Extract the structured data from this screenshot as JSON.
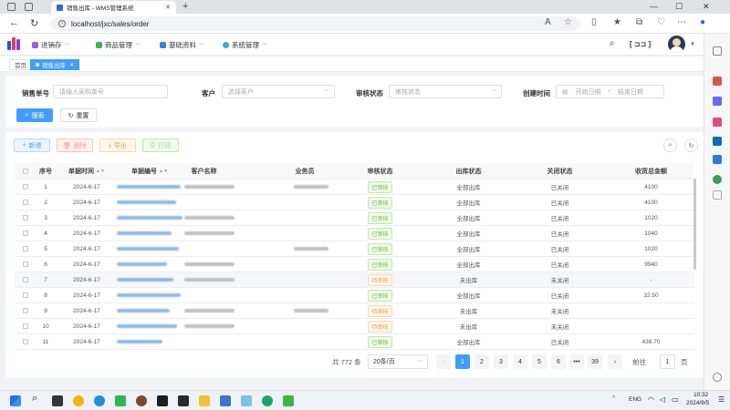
{
  "browser": {
    "tab_title": "销售出库 - WMS管理系统",
    "url": "localhost/jxc/sales/order"
  },
  "app": {
    "menus": [
      {
        "label": "进销存",
        "color": "#8e5cf7"
      },
      {
        "label": "商品管理",
        "color": "#3fb34f"
      },
      {
        "label": "基础资料",
        "color": "#3a7bef"
      },
      {
        "label": "系统管理",
        "color": "#3aa6e8"
      }
    ],
    "header_badge": "[ ⊐⊐ ]"
  },
  "pagetabs": {
    "home": "首页",
    "current": "销售出库"
  },
  "search": {
    "order_no_label": "销售单号",
    "order_no_placeholder": "请输入采购单号",
    "customer_label": "客户",
    "customer_placeholder": "选择客户",
    "audit_label": "审核状态",
    "audit_placeholder": "审核状态",
    "time_label": "创建时间",
    "start_placeholder": "开始日期",
    "range_sep": "-",
    "end_placeholder": "结束日期",
    "search_btn": "搜索",
    "reset_btn": "重置"
  },
  "toolbar": {
    "add": "新增",
    "delete": "删除",
    "export": "导出",
    "print": "打印"
  },
  "table": {
    "headers": {
      "index": "序号",
      "time": "单据时间",
      "code": "单据编号",
      "customer": "客户名称",
      "staff": "业务员",
      "audit": "审核状态",
      "outstock": "出库状态",
      "close": "关闭状态",
      "amount": "收货总金额"
    },
    "rows": [
      {
        "no": "1",
        "date": "2024-6-17",
        "audit": "已审核",
        "audit_type": "ok",
        "out": "全部出库",
        "close": "已关闭",
        "amount": "4100"
      },
      {
        "no": "2",
        "date": "2024-6-17",
        "audit": "已审核",
        "audit_type": "ok",
        "out": "全部出库",
        "close": "已关闭",
        "amount": "4100"
      },
      {
        "no": "3",
        "date": "2024-6-17",
        "audit": "已审核",
        "audit_type": "ok",
        "out": "全部出库",
        "close": "已关闭",
        "amount": "1020"
      },
      {
        "no": "4",
        "date": "2024-6-17",
        "audit": "已审核",
        "audit_type": "ok",
        "out": "全部出库",
        "close": "已关闭",
        "amount": "1040"
      },
      {
        "no": "5",
        "date": "2024-6-17",
        "audit": "已审核",
        "audit_type": "ok",
        "out": "全部出库",
        "close": "已关闭",
        "amount": "1020"
      },
      {
        "no": "6",
        "date": "2024-6-17",
        "audit": "已审核",
        "audit_type": "ok",
        "out": "全部出库",
        "close": "已关闭",
        "amount": "9940"
      },
      {
        "no": "7",
        "date": "2024-6-17",
        "audit": "待审核",
        "audit_type": "wait",
        "out": "未出库",
        "close": "未关闭",
        "amount": "-"
      },
      {
        "no": "8",
        "date": "2024-6-17",
        "audit": "已审核",
        "audit_type": "ok",
        "out": "全部出库",
        "close": "已关闭",
        "amount": "32.50"
      },
      {
        "no": "9",
        "date": "2024-6-17",
        "audit": "待审核",
        "audit_type": "wait",
        "out": "未出库",
        "close": "未关闭",
        "amount": ""
      },
      {
        "no": "10",
        "date": "2024-6-17",
        "audit": "待审核",
        "audit_type": "wait",
        "out": "未出库",
        "close": "未关闭",
        "amount": ""
      },
      {
        "no": "11",
        "date": "2024-6-17",
        "audit": "已审核",
        "audit_type": "ok",
        "out": "全部出库",
        "close": "已关闭",
        "amount": "438.70"
      }
    ]
  },
  "pagination": {
    "total": "共 772 条",
    "page_size": "20条/页",
    "pages": [
      "1",
      "2",
      "3",
      "4",
      "5",
      "6",
      "•••",
      "39"
    ],
    "goto_label": "前往",
    "goto_value": "1",
    "page_suffix": "页"
  },
  "taskbar": {
    "lang": "ENG",
    "time": "10:32",
    "date": "2024/9/5"
  }
}
